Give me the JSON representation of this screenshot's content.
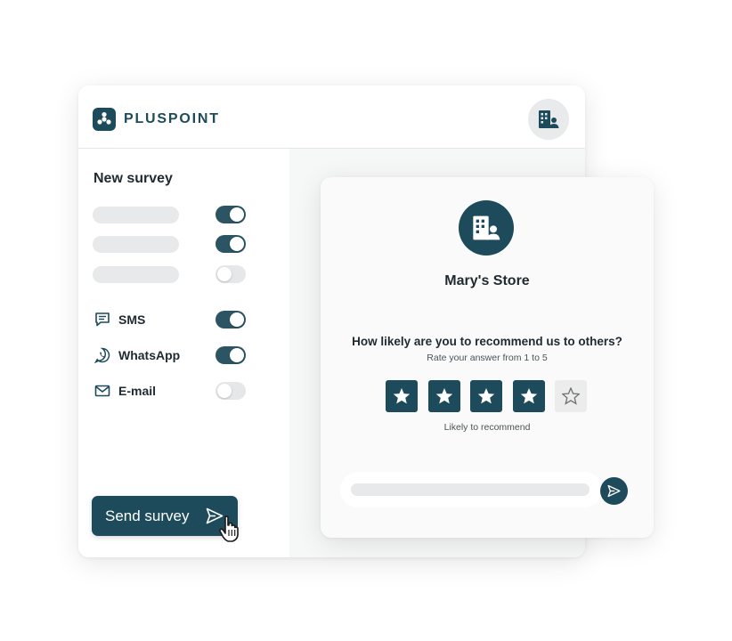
{
  "header": {
    "brand_name": "PLUSPOINT",
    "avatar_icon": "building-user-icon"
  },
  "colors": {
    "brand": "#1d4b5c",
    "toggle_on": "#2c5563",
    "toggle_off": "#e6e7e8",
    "placeholder": "#e8e9ea"
  },
  "left_panel": {
    "title": "New survey",
    "options": [
      {
        "enabled": true
      },
      {
        "enabled": true
      },
      {
        "enabled": false
      }
    ],
    "channels": [
      {
        "icon": "chat-icon",
        "label": "SMS",
        "enabled": true
      },
      {
        "icon": "whatsapp-icon",
        "label": "WhatsApp",
        "enabled": true
      },
      {
        "icon": "mail-icon",
        "label": "E-mail",
        "enabled": false
      }
    ],
    "send_button": {
      "label": "Send survey",
      "icon": "send-icon"
    }
  },
  "survey": {
    "store_name": "Mary's Store",
    "question": "How likely are you to recommend us to others?",
    "hint": "Rate your answer from 1 to 5",
    "rating": 4,
    "max_rating": 5,
    "rating_label": "Likely to recommend",
    "submit_icon": "send-icon"
  }
}
